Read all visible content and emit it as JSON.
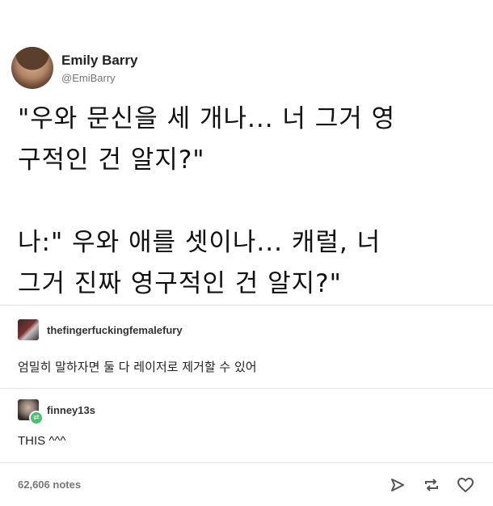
{
  "post": {
    "author_name": "Emily Barry",
    "author_handle": "@EmiBarry",
    "text_lines": [
      "\"우와 문신을 세 개나... 너 그거 영",
      "구적인 건 알지?\"",
      "",
      "나:\" 우와 애를 셋이나... 캐럴, 너",
      "그거 진짜 영구적인 건 알지?\""
    ]
  },
  "replies": [
    {
      "user": "thefingerfuckingfemalefury",
      "text": "엄밀히 말하자면 둘 다 레이저로 제거할 수 있어"
    },
    {
      "user": "finney13s",
      "text": "THIS ^^^"
    }
  ],
  "footer": {
    "notes": "62,606 notes",
    "icons": [
      "share-icon",
      "reblog-icon",
      "like-icon"
    ]
  }
}
